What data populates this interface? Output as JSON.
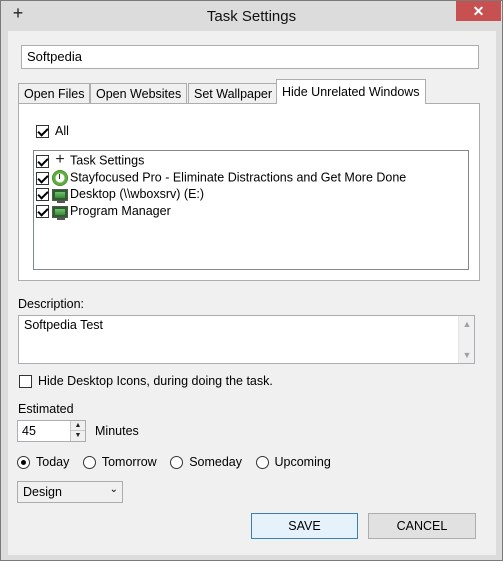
{
  "window": {
    "title": "Task Settings",
    "close_label": "✕"
  },
  "task_name": {
    "value": "Softpedia"
  },
  "tabs": [
    {
      "label": "Open Files"
    },
    {
      "label": "Open Websites"
    },
    {
      "label": "Set Wallpaper"
    },
    {
      "label": "Hide Unrelated Windows"
    }
  ],
  "hide_windows": {
    "all_label": "All",
    "all_checked": true,
    "items": [
      {
        "label": "Task Settings",
        "icon": "plus-icon",
        "checked": true
      },
      {
        "label": "Stayfocused Pro - Eliminate Distractions and Get More Done",
        "icon": "clock-icon",
        "checked": true
      },
      {
        "label": "Desktop (\\\\wboxsrv) (E:)",
        "icon": "monitor-icon",
        "checked": true
      },
      {
        "label": "Program Manager",
        "icon": "monitor-icon",
        "checked": true
      }
    ]
  },
  "description": {
    "label": "Description:",
    "value": "Softpedia Test"
  },
  "hide_desktop": {
    "label": "Hide Desktop Icons, during doing the task.",
    "checked": false
  },
  "estimated": {
    "label": "Estimated",
    "value": "45",
    "unit": "Minutes"
  },
  "when": {
    "options": [
      "Today",
      "Tomorrow",
      "Someday",
      "Upcoming"
    ],
    "selected": "Today"
  },
  "category": {
    "selected": "Design"
  },
  "buttons": {
    "save": "SAVE",
    "cancel": "CANCEL"
  },
  "colors": {
    "close": "#c75050",
    "default_border": "#3c7fb1"
  }
}
